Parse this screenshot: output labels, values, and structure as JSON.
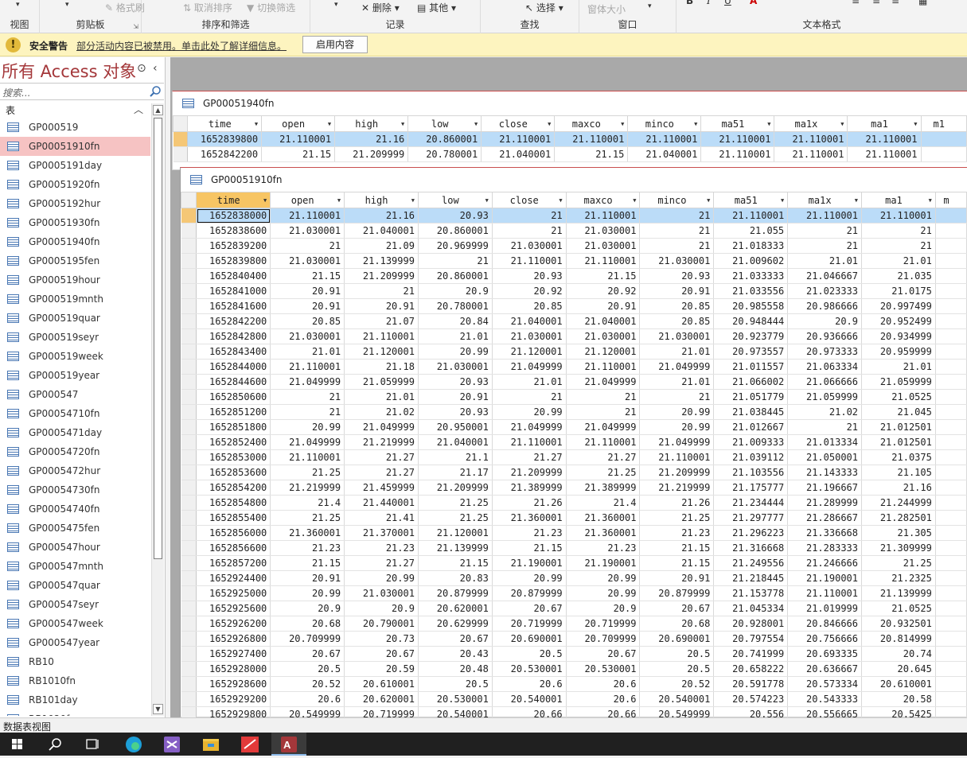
{
  "ribbon": {
    "groups": {
      "view": "视图",
      "clipboard": "剪贴板",
      "sort_filter": "排序和筛选",
      "records": "记录",
      "find": "查找",
      "window": "窗口",
      "text_format": "文本格式"
    },
    "buttons": {
      "format_painter": "格式刷",
      "clear_sort": "取消排序",
      "toggle_filter": "切换筛选",
      "delete": "删除",
      "more": "其他",
      "select": "选择",
      "window_size": "窗体大小"
    }
  },
  "security_bar": {
    "title": "安全警告",
    "message": "部分活动内容已被禁用。单击此处了解详细信息。",
    "button": "启用内容"
  },
  "nav": {
    "title": "所有 Access 对象",
    "search_placeholder": "搜索...",
    "group_label": "表",
    "items": [
      {
        "label": "GP000519"
      },
      {
        "label": "GP00051910fn"
      },
      {
        "label": "GP0005191day"
      },
      {
        "label": "GP00051920fn"
      },
      {
        "label": "GP0005192hur"
      },
      {
        "label": "GP00051930fn"
      },
      {
        "label": "GP00051940fn"
      },
      {
        "label": "GP0005195fen"
      },
      {
        "label": "GP000519hour"
      },
      {
        "label": "GP000519mnth"
      },
      {
        "label": "GP000519quar"
      },
      {
        "label": "GP000519seyr"
      },
      {
        "label": "GP000519week"
      },
      {
        "label": "GP000519year"
      },
      {
        "label": "GP000547"
      },
      {
        "label": "GP00054710fn"
      },
      {
        "label": "GP0005471day"
      },
      {
        "label": "GP00054720fn"
      },
      {
        "label": "GP0005472hur"
      },
      {
        "label": "GP00054730fn"
      },
      {
        "label": "GP00054740fn"
      },
      {
        "label": "GP0005475fen"
      },
      {
        "label": "GP000547hour"
      },
      {
        "label": "GP000547mnth"
      },
      {
        "label": "GP000547quar"
      },
      {
        "label": "GP000547seyr"
      },
      {
        "label": "GP000547week"
      },
      {
        "label": "GP000547year"
      },
      {
        "label": "RB10"
      },
      {
        "label": "RB1010fn"
      },
      {
        "label": "RB101day"
      },
      {
        "label": "RB1020fn"
      }
    ],
    "selected_index": 1
  },
  "window1": {
    "title": "GP00051940fn",
    "columns": [
      "time",
      "open",
      "high",
      "low",
      "close",
      "maxco",
      "minco",
      "ma51",
      "ma1x",
      "ma1",
      "m1"
    ],
    "rows": [
      [
        "1652839800",
        "21.110001",
        "21.16",
        "20.860001",
        "21.110001",
        "21.110001",
        "21.110001",
        "21.110001",
        "21.110001",
        "21.110001",
        ""
      ],
      [
        "1652842200",
        "21.15",
        "21.209999",
        "20.780001",
        "21.040001",
        "21.15",
        "21.040001",
        "21.110001",
        "21.110001",
        "21.110001",
        ""
      ]
    ]
  },
  "window2": {
    "title": "GP00051910fn",
    "columns": [
      "time",
      "open",
      "high",
      "low",
      "close",
      "maxco",
      "minco",
      "ma51",
      "ma1x",
      "ma1",
      "m"
    ],
    "rows": [
      [
        "1652838000",
        "21.110001",
        "21.16",
        "20.93",
        "21",
        "21.110001",
        "21",
        "21.110001",
        "21.110001",
        "21.110001"
      ],
      [
        "1652838600",
        "21.030001",
        "21.040001",
        "20.860001",
        "21",
        "21.030001",
        "21",
        "21.055",
        "21",
        "21"
      ],
      [
        "1652839200",
        "21",
        "21.09",
        "20.969999",
        "21.030001",
        "21.030001",
        "21",
        "21.018333",
        "21",
        "21"
      ],
      [
        "1652839800",
        "21.030001",
        "21.139999",
        "21",
        "21.110001",
        "21.110001",
        "21.030001",
        "21.009602",
        "21.01",
        "21.01"
      ],
      [
        "1652840400",
        "21.15",
        "21.209999",
        "20.860001",
        "20.93",
        "21.15",
        "20.93",
        "21.033333",
        "21.046667",
        "21.035"
      ],
      [
        "1652841000",
        "20.91",
        "21",
        "20.9",
        "20.92",
        "20.92",
        "20.91",
        "21.033556",
        "21.023333",
        "21.0175"
      ],
      [
        "1652841600",
        "20.91",
        "20.91",
        "20.780001",
        "20.85",
        "20.91",
        "20.85",
        "20.985558",
        "20.986666",
        "20.997499"
      ],
      [
        "1652842200",
        "20.85",
        "21.07",
        "20.84",
        "21.040001",
        "21.040001",
        "20.85",
        "20.948444",
        "20.9",
        "20.952499"
      ],
      [
        "1652842800",
        "21.030001",
        "21.110001",
        "21.01",
        "21.030001",
        "21.030001",
        "21.030001",
        "20.923779",
        "20.936666",
        "20.934999"
      ],
      [
        "1652843400",
        "21.01",
        "21.120001",
        "20.99",
        "21.120001",
        "21.120001",
        "21.01",
        "20.973557",
        "20.973333",
        "20.959999"
      ],
      [
        "1652844000",
        "21.110001",
        "21.18",
        "21.030001",
        "21.049999",
        "21.110001",
        "21.049999",
        "21.011557",
        "21.063334",
        "21.01"
      ],
      [
        "1652844600",
        "21.049999",
        "21.059999",
        "20.93",
        "21.01",
        "21.049999",
        "21.01",
        "21.066002",
        "21.066666",
        "21.059999"
      ],
      [
        "1652850600",
        "21",
        "21.01",
        "20.91",
        "21",
        "21",
        "21",
        "21.051779",
        "21.059999",
        "21.0525"
      ],
      [
        "1652851200",
        "21",
        "21.02",
        "20.93",
        "20.99",
        "21",
        "20.99",
        "21.038445",
        "21.02",
        "21.045"
      ],
      [
        "1652851800",
        "20.99",
        "21.049999",
        "20.950001",
        "21.049999",
        "21.049999",
        "20.99",
        "21.012667",
        "21",
        "21.012501"
      ],
      [
        "1652852400",
        "21.049999",
        "21.219999",
        "21.040001",
        "21.110001",
        "21.110001",
        "21.049999",
        "21.009333",
        "21.013334",
        "21.012501"
      ],
      [
        "1652853000",
        "21.110001",
        "21.27",
        "21.1",
        "21.27",
        "21.27",
        "21.110001",
        "21.039112",
        "21.050001",
        "21.0375"
      ],
      [
        "1652853600",
        "21.25",
        "21.27",
        "21.17",
        "21.209999",
        "21.25",
        "21.209999",
        "21.103556",
        "21.143333",
        "21.105"
      ],
      [
        "1652854200",
        "21.219999",
        "21.459999",
        "21.209999",
        "21.389999",
        "21.389999",
        "21.219999",
        "21.175777",
        "21.196667",
        "21.16"
      ],
      [
        "1652854800",
        "21.4",
        "21.440001",
        "21.25",
        "21.26",
        "21.4",
        "21.26",
        "21.234444",
        "21.289999",
        "21.244999"
      ],
      [
        "1652855400",
        "21.25",
        "21.41",
        "21.25",
        "21.360001",
        "21.360001",
        "21.25",
        "21.297777",
        "21.286667",
        "21.282501"
      ],
      [
        "1652856000",
        "21.360001",
        "21.370001",
        "21.120001",
        "21.23",
        "21.360001",
        "21.23",
        "21.296223",
        "21.336668",
        "21.305"
      ],
      [
        "1652856600",
        "21.23",
        "21.23",
        "21.139999",
        "21.15",
        "21.23",
        "21.15",
        "21.316668",
        "21.283333",
        "21.309999"
      ],
      [
        "1652857200",
        "21.15",
        "21.27",
        "21.15",
        "21.190001",
        "21.190001",
        "21.15",
        "21.249556",
        "21.246666",
        "21.25"
      ],
      [
        "1652924400",
        "20.91",
        "20.99",
        "20.83",
        "20.99",
        "20.99",
        "20.91",
        "21.218445",
        "21.190001",
        "21.2325"
      ],
      [
        "1652925000",
        "20.99",
        "21.030001",
        "20.879999",
        "20.879999",
        "20.99",
        "20.879999",
        "21.153778",
        "21.110001",
        "21.139999"
      ],
      [
        "1652925600",
        "20.9",
        "20.9",
        "20.620001",
        "20.67",
        "20.9",
        "20.67",
        "21.045334",
        "21.019999",
        "21.0525"
      ],
      [
        "1652926200",
        "20.68",
        "20.790001",
        "20.629999",
        "20.719999",
        "20.719999",
        "20.68",
        "20.928001",
        "20.846666",
        "20.932501"
      ],
      [
        "1652926800",
        "20.709999",
        "20.73",
        "20.67",
        "20.690001",
        "20.709999",
        "20.690001",
        "20.797554",
        "20.756666",
        "20.814999"
      ],
      [
        "1652927400",
        "20.67",
        "20.67",
        "20.43",
        "20.5",
        "20.67",
        "20.5",
        "20.741999",
        "20.693335",
        "20.74"
      ],
      [
        "1652928000",
        "20.5",
        "20.59",
        "20.48",
        "20.530001",
        "20.530001",
        "20.5",
        "20.658222",
        "20.636667",
        "20.645"
      ],
      [
        "1652928600",
        "20.52",
        "20.610001",
        "20.5",
        "20.6",
        "20.6",
        "20.52",
        "20.591778",
        "20.573334",
        "20.610001"
      ],
      [
        "1652929200",
        "20.6",
        "20.620001",
        "20.530001",
        "20.540001",
        "20.6",
        "20.540001",
        "20.574223",
        "20.543333",
        "20.58"
      ],
      [
        "1652929800",
        "20.549999",
        "20.719999",
        "20.540001",
        "20.66",
        "20.66",
        "20.549999",
        "20.556",
        "20.556665",
        "20.5425"
      ]
    ]
  },
  "status_bar": {
    "text": "数据表视图"
  },
  "colors": {
    "accent_red": "#a4373a",
    "selection_blue": "#bbdcf8",
    "warning_bg": "#fdf4bf"
  }
}
